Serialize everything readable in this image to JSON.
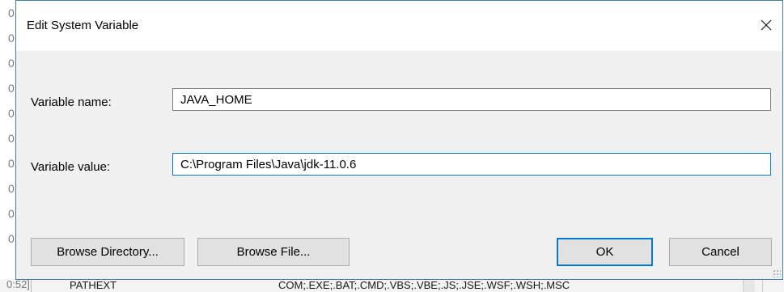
{
  "background": {
    "left_column_values": [
      "0",
      "0",
      "0",
      "0",
      "0",
      "0",
      "0",
      "0",
      "0",
      "0"
    ],
    "bottom_row": {
      "left_value": "0:52]",
      "name": "PATHEXT",
      "value": "COM;.EXE;.BAT;.CMD;.VBS;.VBE;.JS;.JSE;.WSF;.WSH;.MSC"
    }
  },
  "dialog": {
    "title": "Edit System Variable",
    "close_icon": "close-icon",
    "variable_name_label": "Variable name:",
    "variable_name_value": "JAVA_HOME",
    "variable_value_label": "Variable value:",
    "variable_value_value": "C:\\Program Files\\Java\\jdk-11.0.6",
    "buttons": {
      "browse_directory": "Browse Directory...",
      "browse_file": "Browse File...",
      "ok": "OK",
      "cancel": "Cancel"
    },
    "colors": {
      "accent": "#0078d7",
      "frame_border": "#3c7fb1",
      "client_bg": "#f0f0f0",
      "button_bg": "#e1e1e1"
    }
  }
}
